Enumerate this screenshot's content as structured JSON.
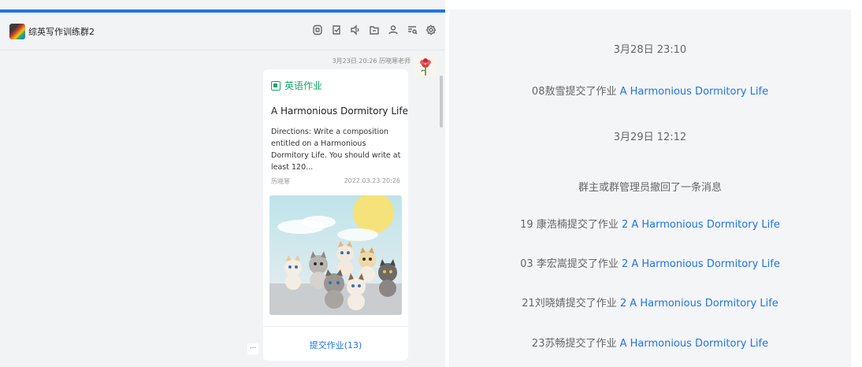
{
  "header": {
    "group_name": "综英写作训练群2",
    "icons": [
      "document-icon",
      "checklist-icon",
      "voice-icon",
      "folder-icon",
      "members-icon",
      "search-history-icon",
      "settings-icon"
    ]
  },
  "message": {
    "meta": "3月23日 20:26 历晓寒老师"
  },
  "card": {
    "tag": "英语作业",
    "title": "A Harmonious Dormitory Life",
    "description": "Directions:   Write a composition entitled on a Harmonious Dormitory Life. You should write at least 120...",
    "author": "历晓寒",
    "date": "2022.03.23 20:26",
    "submit_label": "提交作业(13)"
  },
  "more": "...",
  "right_panel": {
    "timestamps": [
      "3月28日 23:10",
      "3月29日 12:12"
    ],
    "entries": [
      {
        "prefix": "08敖雪提交了作业 ",
        "link": "A Harmonious Dormitory Life"
      },
      {
        "prefix": "群主或群管理员撤回了一条消息",
        "link": ""
      },
      {
        "prefix": "19 康浩楠提交了作业 ",
        "link": "2 A Harmonious Dormitory Life"
      },
      {
        "prefix": "03 李宏嵩提交了作业 ",
        "link": "2 A Harmonious Dormitory Life"
      },
      {
        "prefix": "21刘晓婧提交了作业 ",
        "link": "2 A Harmonious Dormitory Life"
      },
      {
        "prefix": "23苏畅提交了作业 ",
        "link": "A Harmonious Dormitory Life"
      }
    ]
  },
  "colors": {
    "accent": "#1e74e8",
    "tag_green": "#12a86b",
    "pane_bg": "#f2f3f5"
  }
}
